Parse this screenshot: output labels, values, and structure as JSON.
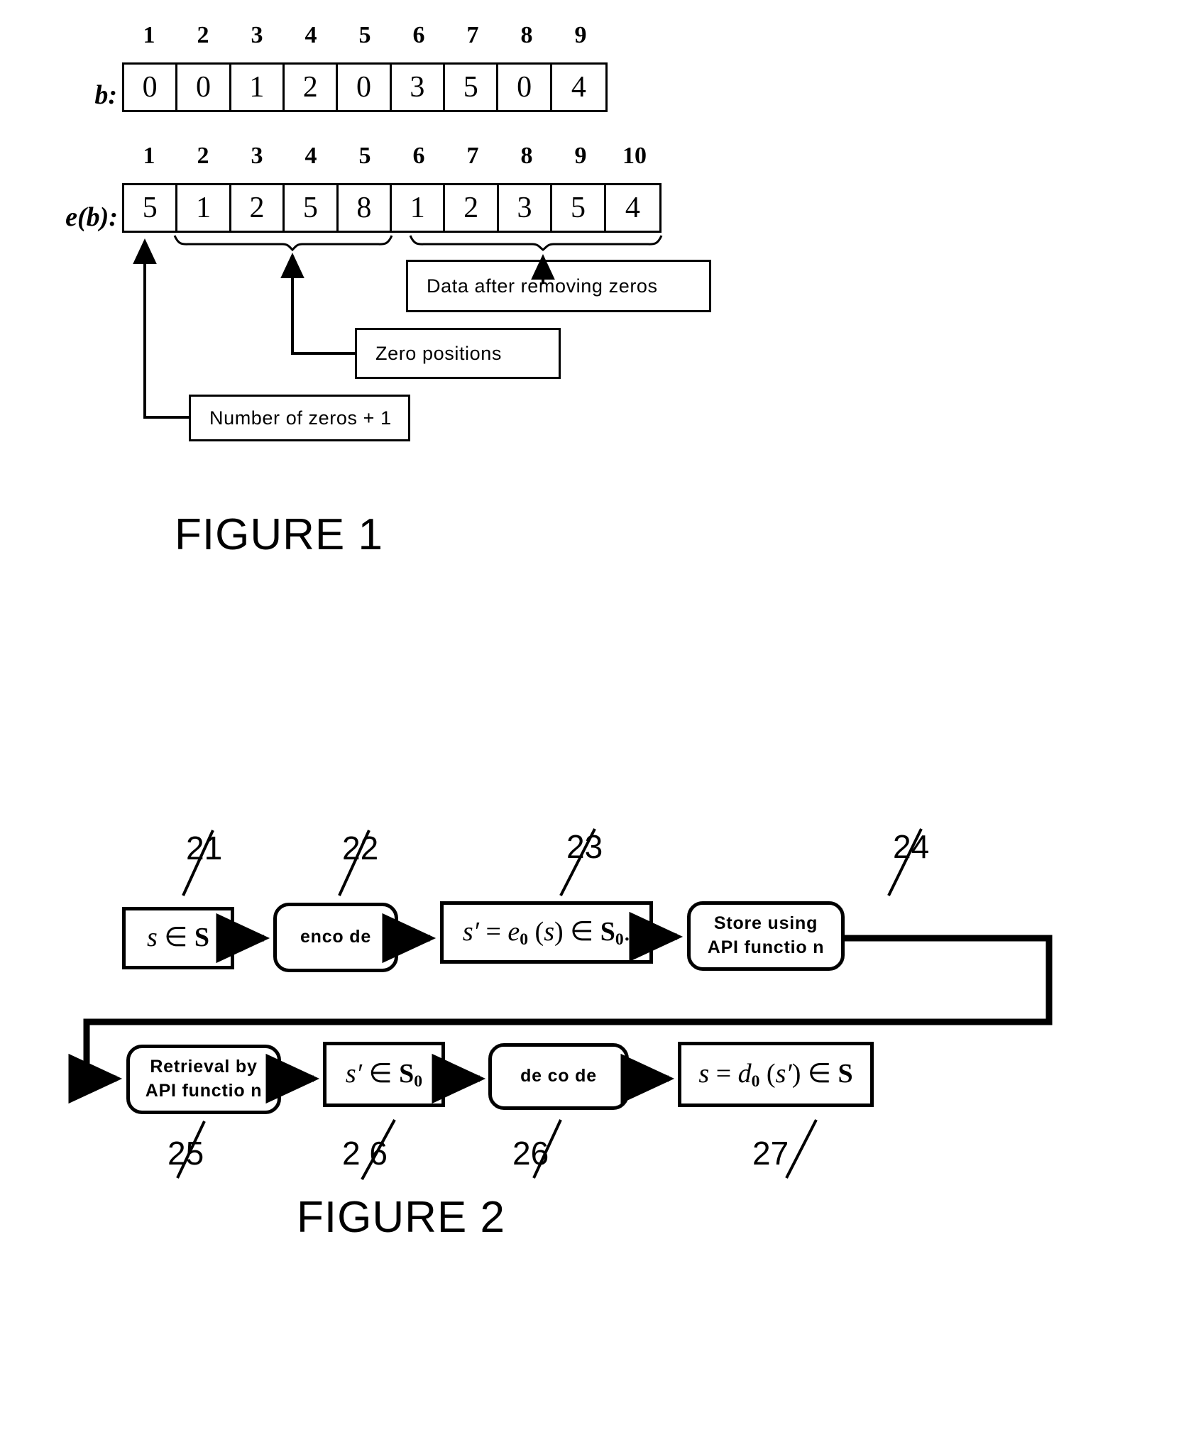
{
  "figure1": {
    "caption": "FIGURE 1",
    "arrays": [
      {
        "name": "b",
        "label": "b:",
        "indices": [
          "1",
          "2",
          "3",
          "4",
          "5",
          "6",
          "7",
          "8",
          "9"
        ],
        "values": [
          "0",
          "0",
          "1",
          "2",
          "0",
          "3",
          "5",
          "0",
          "4"
        ]
      },
      {
        "name": "e(b)",
        "label": "e(b):",
        "indices": [
          "1",
          "2",
          "3",
          "4",
          "5",
          "6",
          "7",
          "8",
          "9",
          "10"
        ],
        "values": [
          "5",
          "1",
          "2",
          "5",
          "8",
          "1",
          "2",
          "3",
          "5",
          "4"
        ]
      }
    ],
    "callouts": [
      {
        "id": "data-after-removing-zeros",
        "text": "Data after removing zeros"
      },
      {
        "id": "zero-positions",
        "text": "Zero positions"
      },
      {
        "id": "number-of-zeros-plus-one",
        "text": "Number of zeros + 1"
      }
    ]
  },
  "figure2": {
    "caption": "FIGURE 2",
    "nodes": [
      {
        "id": "source-data",
        "ref": "21",
        "shape": "torn",
        "text": "s ∈ S",
        "math": true
      },
      {
        "id": "encode",
        "ref": "22",
        "shape": "rounded",
        "text": "enco de",
        "math": false
      },
      {
        "id": "encoded-data",
        "ref": "23",
        "shape": "torn",
        "text": "s′ = e0 (s) ∈ S0",
        "math": true
      },
      {
        "id": "store-using-api-function",
        "ref": "24",
        "shape": "rounded",
        "text": "Store using\nAPI functio n",
        "math": false
      },
      {
        "id": "retrieval-by-api-function",
        "ref": "25",
        "shape": "rounded",
        "text": "Retrieval by\nAPI functio n",
        "math": false
      },
      {
        "id": "retrieved-data",
        "ref": "2 6",
        "shape": "torn",
        "text": "s′ ∈ S0",
        "math": true
      },
      {
        "id": "decode",
        "ref": "26",
        "shape": "rounded",
        "text": "de co de",
        "math": false
      },
      {
        "id": "decoded-data",
        "ref": "27",
        "shape": "torn",
        "text": "s = d0 (s′) ∈ S",
        "math": true
      }
    ]
  }
}
